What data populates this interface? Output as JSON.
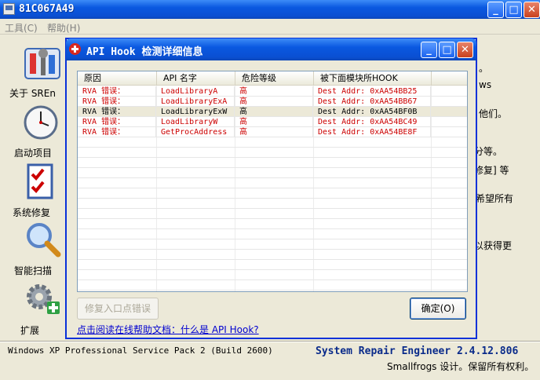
{
  "window": {
    "title": "81C067A49"
  },
  "menu": {
    "items": [
      {
        "label": "工具(C)"
      },
      {
        "label": "帮助(H)"
      }
    ]
  },
  "sidebar": {
    "items": [
      {
        "label": "关于 SREn",
        "icon": "tools-icon"
      },
      {
        "label": "启动项目",
        "icon": "clock-icon"
      },
      {
        "label": "系统修复",
        "icon": "checklist-icon"
      },
      {
        "label": "智能扫描",
        "icon": "magnifier-icon"
      },
      {
        "label": "扩展",
        "icon": "gear-plus-icon"
      }
    ]
  },
  "background_text": [
    "。",
    "ws",
    "他们。",
    "分等。",
    "修复] 等",
    "希望所有",
    "以获得更"
  ],
  "status": {
    "os": "Windows XP Professional Service Pack 2 (Build 2600)",
    "app": "System Repair Engineer 2.4.12.806",
    "copyright": "Smallfrogs 设计。保留所有权利。"
  },
  "dialog": {
    "title": "API Hook 检测详细信息",
    "columns": [
      "原因",
      "API 名字",
      "危险等级",
      "被下面模块所HOOK"
    ],
    "rows": [
      {
        "reason": "RVA  错误：",
        "api": "LoadLibraryA",
        "level": "高",
        "module": "Dest Addr: 0xAA54BB25",
        "selected": false
      },
      {
        "reason": "RVA  错误：",
        "api": "LoadLibraryExA",
        "level": "高",
        "module": "Dest Addr: 0xAA54BB67",
        "selected": false
      },
      {
        "reason": "RVA  错误：",
        "api": "LoadLibraryExW",
        "level": "高",
        "module": "Dest Addr: 0xAA54BF0B",
        "selected": true
      },
      {
        "reason": "RVA  错误：",
        "api": "LoadLibraryW",
        "level": "高",
        "module": "Dest Addr: 0xAA54BC49",
        "selected": false
      },
      {
        "reason": "RVA  错误：",
        "api": "GetProcAddress",
        "level": "高",
        "module": "Dest Addr: 0xAA54BE8F",
        "selected": false
      }
    ],
    "fix_button": "修复入口点错误",
    "ok_button": "确定(O)",
    "help_link": "点击阅读在线帮助文档：什么是 API Hook?"
  },
  "colors": {
    "row_text_red": "#cc0000",
    "row_text_selected": "#000000",
    "titlebar_blue": "#0a58e0"
  }
}
